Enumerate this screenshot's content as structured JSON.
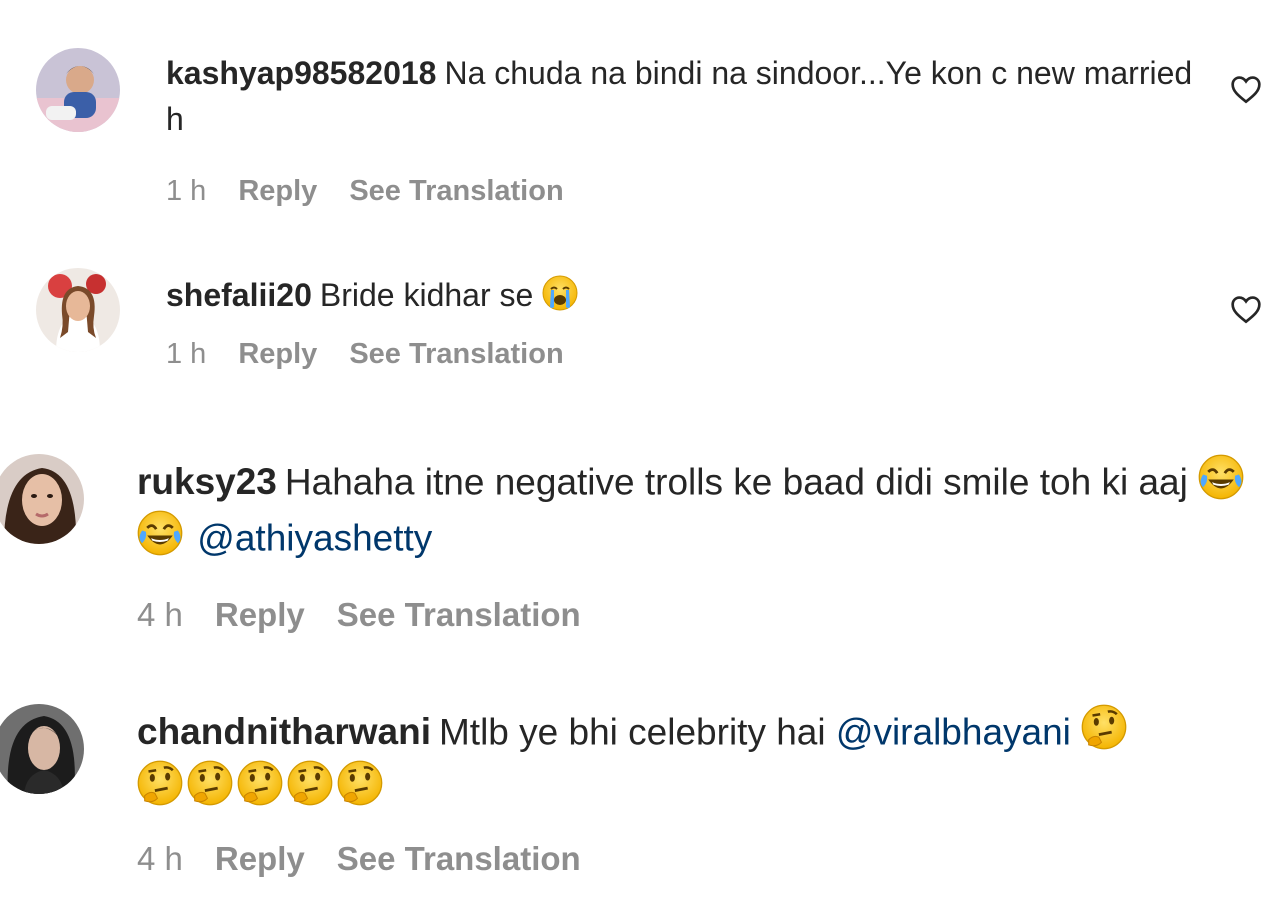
{
  "comments": [
    {
      "username": "kashyap98582018",
      "text": "Na chuda na bindi na sindoor...Ye kon c new married h",
      "time": "1 h",
      "reply_label": "Reply",
      "translation_label": "See Translation"
    },
    {
      "username": "shefalii20",
      "text": "Bride kidhar se",
      "emojis": [
        "loudly-crying-face"
      ],
      "time": "1 h",
      "reply_label": "Reply",
      "translation_label": "See Translation"
    },
    {
      "username": "ruksy23",
      "text": "Hahaha itne negative trolls ke baad didi smile toh ki aaj",
      "emojis": [
        "face-with-tears-of-joy",
        "face-with-tears-of-joy"
      ],
      "mention": "@athiyashetty",
      "time": "4 h",
      "reply_label": "Reply",
      "translation_label": "See Translation"
    },
    {
      "username": "chandnitharwani",
      "text": "Mtlb ye bhi celebrity hai",
      "mention": "@viralbhayani",
      "emojis": [
        "thinking-face",
        "thinking-face",
        "thinking-face",
        "thinking-face",
        "thinking-face",
        "thinking-face"
      ],
      "time": "4 h",
      "reply_label": "Reply",
      "translation_label": "See Translation"
    }
  ],
  "icons": {
    "like": "heart-outline-icon"
  },
  "colors": {
    "text": "#262626",
    "meta": "#8e8e8e",
    "mention": "#00376b",
    "background": "#ffffff"
  }
}
